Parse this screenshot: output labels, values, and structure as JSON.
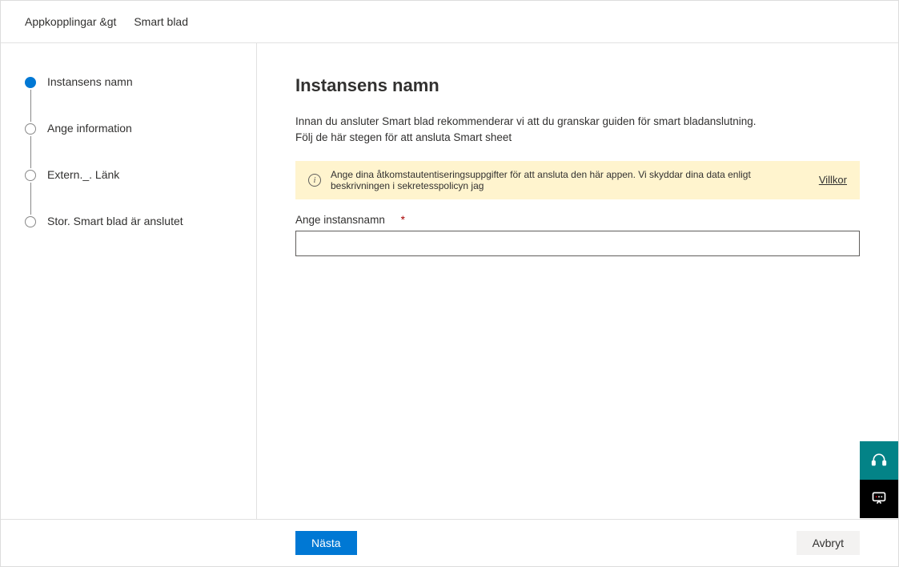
{
  "breadcrumb": {
    "item1": "Appkopplingar &gt",
    "item2": "Smart blad"
  },
  "steps": [
    {
      "label": "Instansens namn",
      "active": true
    },
    {
      "label": "Ange information",
      "active": false
    },
    {
      "label": "Extern._. Länk",
      "active": false
    },
    {
      "label": "Stor. Smart blad är anslutet",
      "active": false
    }
  ],
  "main": {
    "title": "Instansens namn",
    "intro_line1": "Innan du ansluter Smart blad rekommenderar vi att du granskar guiden för smart bladanslutning.",
    "intro_line2": "Följ de här stegen för att ansluta Smart sheet",
    "info_banner": {
      "text": "Ange dina åtkomstautentiseringsuppgifter för att ansluta den här appen. Vi skyddar dina data enligt beskrivningen i sekretesspolicyn jag",
      "link": "Villkor"
    },
    "field": {
      "label": "Ange instansnamn",
      "required": "*",
      "value": ""
    }
  },
  "footer": {
    "next": "Nästa",
    "cancel": "Avbryt"
  },
  "icons": {
    "info": "i",
    "headset": "headset-icon",
    "chat": "chat-icon"
  }
}
